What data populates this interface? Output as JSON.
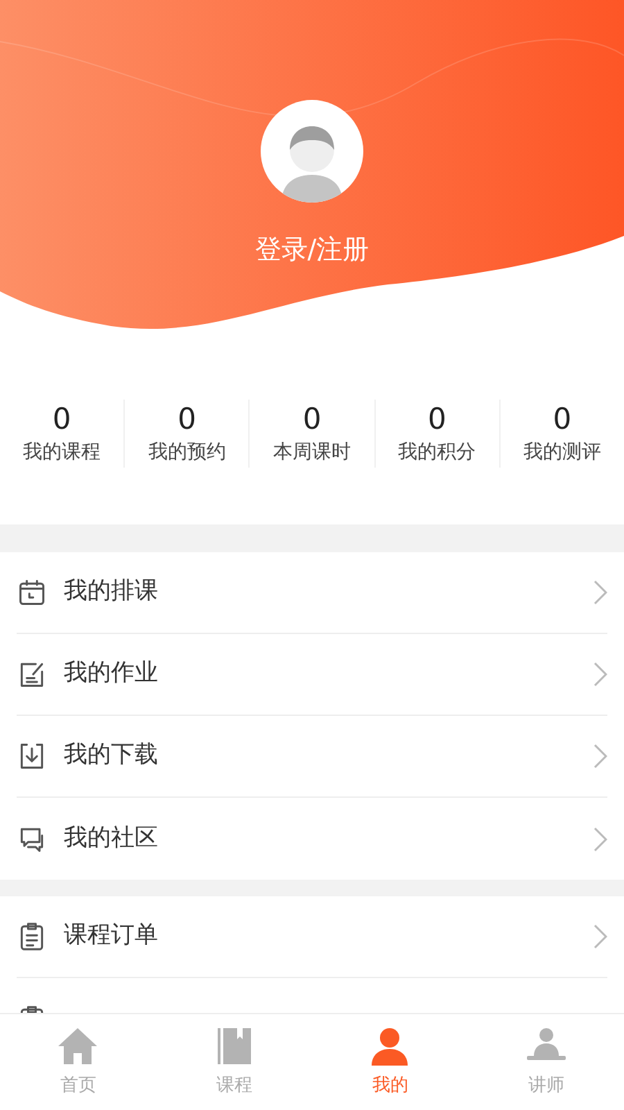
{
  "profile": {
    "login_label": "登录/注册"
  },
  "stats": [
    {
      "value": "0",
      "label": "我的课程"
    },
    {
      "value": "0",
      "label": "我的预约"
    },
    {
      "value": "0",
      "label": "本周课时"
    },
    {
      "value": "0",
      "label": "我的积分"
    },
    {
      "value": "0",
      "label": "我的测评"
    }
  ],
  "menu_groups": [
    [
      {
        "kind": "calendar",
        "label": "我的排课"
      },
      {
        "kind": "homework",
        "label": "我的作业"
      },
      {
        "kind": "download",
        "label": "我的下载"
      },
      {
        "kind": "chat",
        "label": "我的社区"
      }
    ],
    [
      {
        "kind": "clipboard",
        "label": "课程订单"
      },
      {
        "kind": "clipboard"
      }
    ]
  ],
  "tab_bar": [
    {
      "kind": "home",
      "label": "首页",
      "selected": false
    },
    {
      "kind": "book",
      "label": "课程",
      "selected": false
    },
    {
      "kind": "user",
      "label": "我的",
      "selected": true
    },
    {
      "kind": "teacher",
      "label": "讲师",
      "selected": false
    }
  ]
}
